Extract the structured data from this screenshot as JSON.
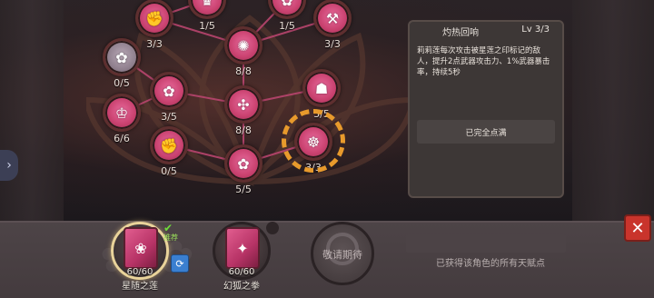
{
  "talent_nodes": [
    {
      "id": "n1",
      "level": "3/3",
      "icon": "fist-icon",
      "locked": false
    },
    {
      "id": "n2",
      "level": "1/5",
      "icon": "helmet-icon",
      "locked": false
    },
    {
      "id": "n3",
      "level": "1/5",
      "icon": "lotus-icon",
      "locked": false
    },
    {
      "id": "n4",
      "level": "3/3",
      "icon": "hammer-icon",
      "locked": false
    },
    {
      "id": "n5",
      "level": "8/8",
      "icon": "bee-icon",
      "locked": false
    },
    {
      "id": "n6",
      "level": "0/5",
      "icon": "lotus-icon",
      "locked": true
    },
    {
      "id": "n7",
      "level": "3/5",
      "icon": "lotus-icon",
      "locked": false
    },
    {
      "id": "n8",
      "level": "6/6",
      "icon": "crown-icon",
      "locked": false
    },
    {
      "id": "n9",
      "level": "8/8",
      "icon": "knot-icon",
      "locked": false
    },
    {
      "id": "n10",
      "level": "3/5",
      "icon": "mask-icon",
      "locked": false
    },
    {
      "id": "n11",
      "level": "0/5",
      "icon": "fist-icon",
      "locked": false
    },
    {
      "id": "n12",
      "level": "5/5",
      "icon": "lotus-icon",
      "locked": false
    },
    {
      "id": "n13",
      "level": "3/3",
      "icon": "tiger-icon",
      "locked": false,
      "selected": true
    }
  ],
  "detail": {
    "title": "灼热回响",
    "level": "Lv 3/3",
    "description": "莉莉莲每次攻击被星莲之印标记的敌人，提升2点武器攻击力、1%武器暴击率，持续5秒",
    "button": "已完全点满"
  },
  "loadouts": [
    {
      "count": "60/60",
      "name": "星随之莲",
      "active": true
    },
    {
      "count": "60/60",
      "name": "幻狐之拳",
      "active": false
    }
  ],
  "disabled_slot": "敬请期待",
  "badge_label": "推荐",
  "info_text": "已获得该角色的所有天赋点",
  "left_tab": "›",
  "close": "✕",
  "colors": {
    "node": "#c9416f",
    "select_ring": "#e89a2c",
    "close": "#c9342c",
    "panel": "#3d3736"
  }
}
